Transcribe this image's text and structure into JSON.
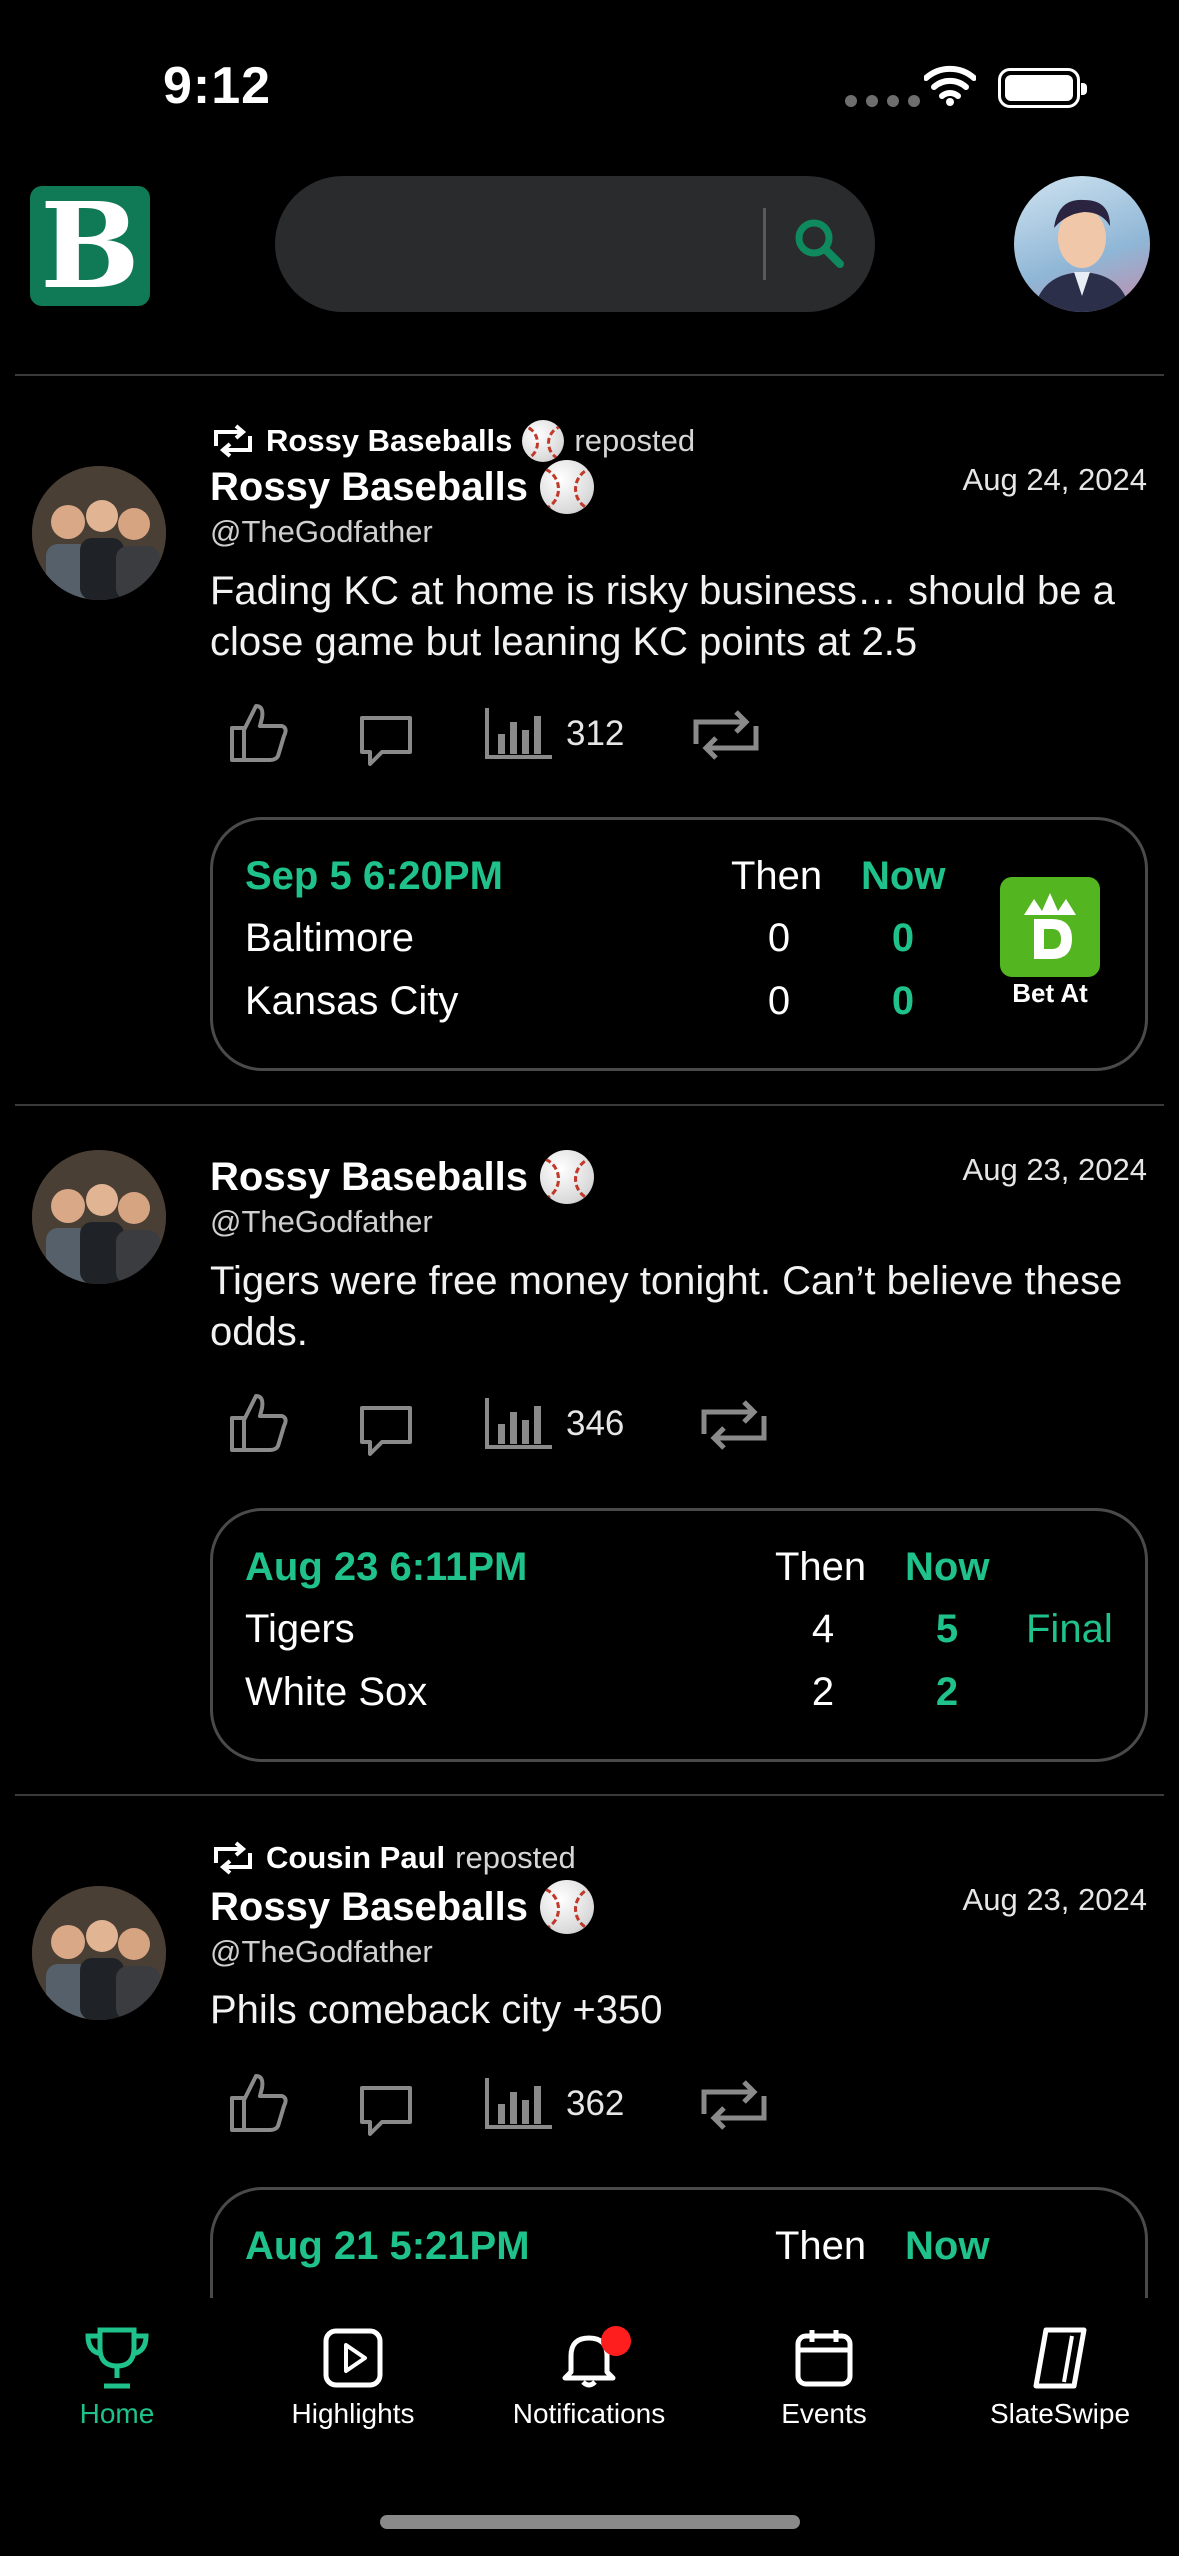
{
  "status_bar": {
    "time": "9:12"
  },
  "header": {
    "logo_letter": "B",
    "search_placeholder": ""
  },
  "colors": {
    "accent": "#1fc28a",
    "logo_bg": "#0f7a55",
    "book_green": "#53b51f",
    "notification_dot": "#ff1e1e"
  },
  "posts": [
    {
      "repost_by": "Rossy Baseballs",
      "repost_suffix": "reposted",
      "author": "Rossy Baseballs",
      "handle": "@TheGodfather",
      "date": "Aug 24, 2024",
      "text": "Fading KC at home is risky business… should be a close game but leaning KC points at 2.5",
      "views": "312",
      "game": {
        "when": "Sep 5 6:20PM",
        "then_label": "Then",
        "now_label": "Now",
        "teams": [
          {
            "name": "Baltimore",
            "then": "0",
            "now": "0"
          },
          {
            "name": "Kansas City",
            "then": "0",
            "now": "0"
          }
        ],
        "book_label": "Bet At"
      }
    },
    {
      "author": "Rossy Baseballs",
      "handle": "@TheGodfather",
      "date": "Aug 23, 2024",
      "text": "Tigers were free money tonight. Can’t believe these odds.",
      "views": "346",
      "game": {
        "when": "Aug 23 6:11PM",
        "then_label": "Then",
        "now_label": "Now",
        "status": "Final",
        "teams": [
          {
            "name": "Tigers",
            "then": "4",
            "now": "5"
          },
          {
            "name": "White Sox",
            "then": "2",
            "now": "2"
          }
        ]
      }
    },
    {
      "repost_by": "Cousin Paul",
      "repost_suffix": "reposted",
      "author": "Rossy Baseballs",
      "handle": "@TheGodfather",
      "date": "Aug 23, 2024",
      "text": "Phils comeback city +350",
      "views": "362",
      "game": {
        "when": "Aug 21 5:21PM",
        "then_label": "Then",
        "now_label": "Now"
      }
    }
  ],
  "tabs": [
    {
      "label": "Home",
      "icon": "trophy-icon",
      "active": true
    },
    {
      "label": "Highlights",
      "icon": "play-icon"
    },
    {
      "label": "Notifications",
      "icon": "bell-icon",
      "badge": true
    },
    {
      "label": "Events",
      "icon": "calendar-icon"
    },
    {
      "label": "SlateSwipe",
      "icon": "cards-icon"
    }
  ]
}
